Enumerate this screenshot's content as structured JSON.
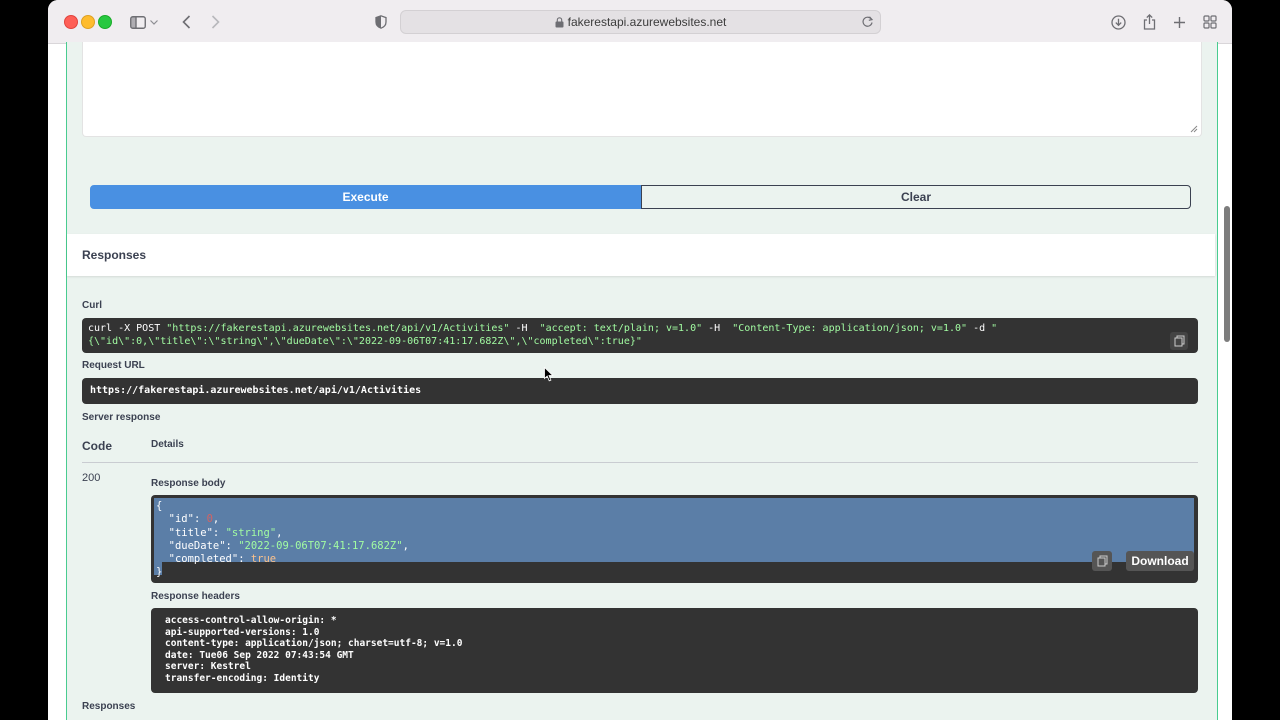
{
  "browser": {
    "url": "fakerestapi.azurewebsites.net"
  },
  "actions": {
    "execute_label": "Execute",
    "clear_label": "Clear"
  },
  "responses": {
    "section_title": "Responses",
    "curl_label": "Curl",
    "curl_line1_plain": "curl -X POST ",
    "curl_line1_url": "\"https://fakerestapi.azurewebsites.net/api/v1/Activities\"",
    "curl_line1_h1": " -H  ",
    "curl_line1_accept": "\"accept: text/plain; v=1.0\"",
    "curl_line1_h2": " -H  ",
    "curl_line1_ct": "\"Content-Type: application/json; v=1.0\"",
    "curl_line1_d": " -d ",
    "curl_line1_q": "\"",
    "curl_line2": "{\\\"id\\\":0,\\\"title\\\":\\\"string\\\",\\\"dueDate\\\":\\\"2022-09-06T07:41:17.682Z\\\",\\\"completed\\\":true}\"",
    "request_url_label": "Request URL",
    "request_url": "https://fakerestapi.azurewebsites.net/api/v1/Activities",
    "server_response_label": "Server response",
    "code_header": "Code",
    "details_header": "Details",
    "code": "200",
    "response_body_label": "Response body",
    "body": {
      "open": "{",
      "id_key": "  \"id\"",
      "id_val": "0",
      "title_key": "  \"title\"",
      "title_val": "\"string\"",
      "due_key": "  \"dueDate\"",
      "due_val": "\"2022-09-06T07:41:17.682Z\"",
      "completed_key": "  \"completed\"",
      "completed_val": "true",
      "close": "}"
    },
    "download_label": "Download",
    "response_headers_label": "Response headers",
    "headers": [
      "access-control-allow-origin: *",
      "api-supported-versions: 1.0",
      "content-type: application/json; charset=utf-8; v=1.0",
      "date: Tue06 Sep 2022 07:43:54 GMT",
      "server: Kestrel",
      "transfer-encoding: Identity"
    ],
    "footer_responses_label": "Responses"
  }
}
